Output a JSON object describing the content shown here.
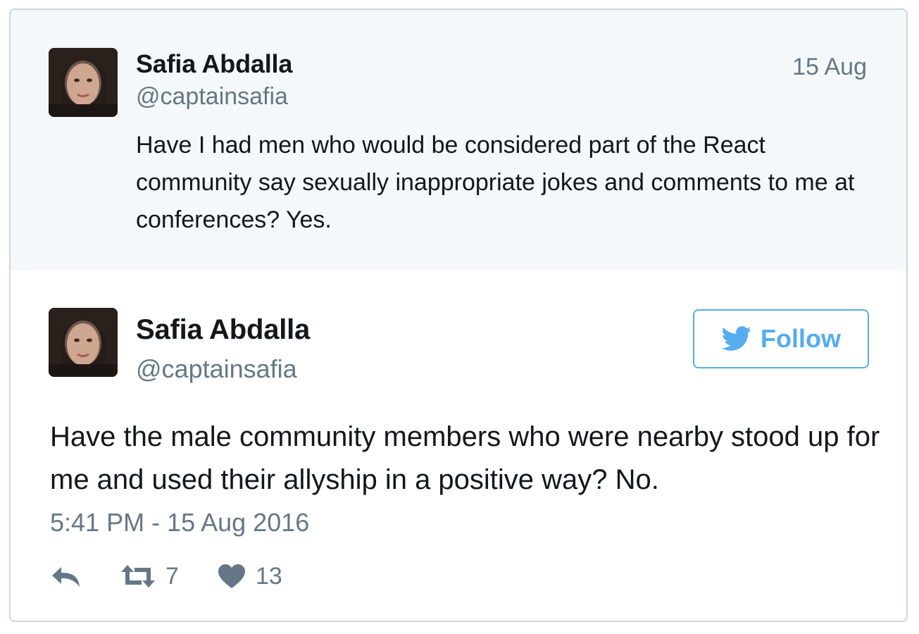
{
  "parent_tweet": {
    "author_name": "Safia Abdalla",
    "handle": "@captainsafia",
    "date": "15 Aug",
    "text": "Have I had men who would be considered part of the React community say sexually inappropriate jokes and comments to me at conferences? Yes."
  },
  "main_tweet": {
    "author_name": "Safia Abdalla",
    "handle": "@captainsafia",
    "follow_label": "Follow",
    "text": "Have the male community members who were nearby stood up for me and used their allyship in a positive way? No.",
    "timestamp": "5:41 PM - 15 Aug 2016",
    "actions": {
      "retweet_count": "7",
      "like_count": "13"
    }
  },
  "icons": {
    "reply": "reply-icon",
    "retweet": "retweet-icon",
    "like": "heart-icon",
    "follow": "twitter-bird-icon"
  },
  "colors": {
    "accent": "#55acee",
    "text": "#14171a",
    "secondary": "#657786",
    "parent_bg": "#f5f8fa",
    "border": "#ccd6dd"
  }
}
